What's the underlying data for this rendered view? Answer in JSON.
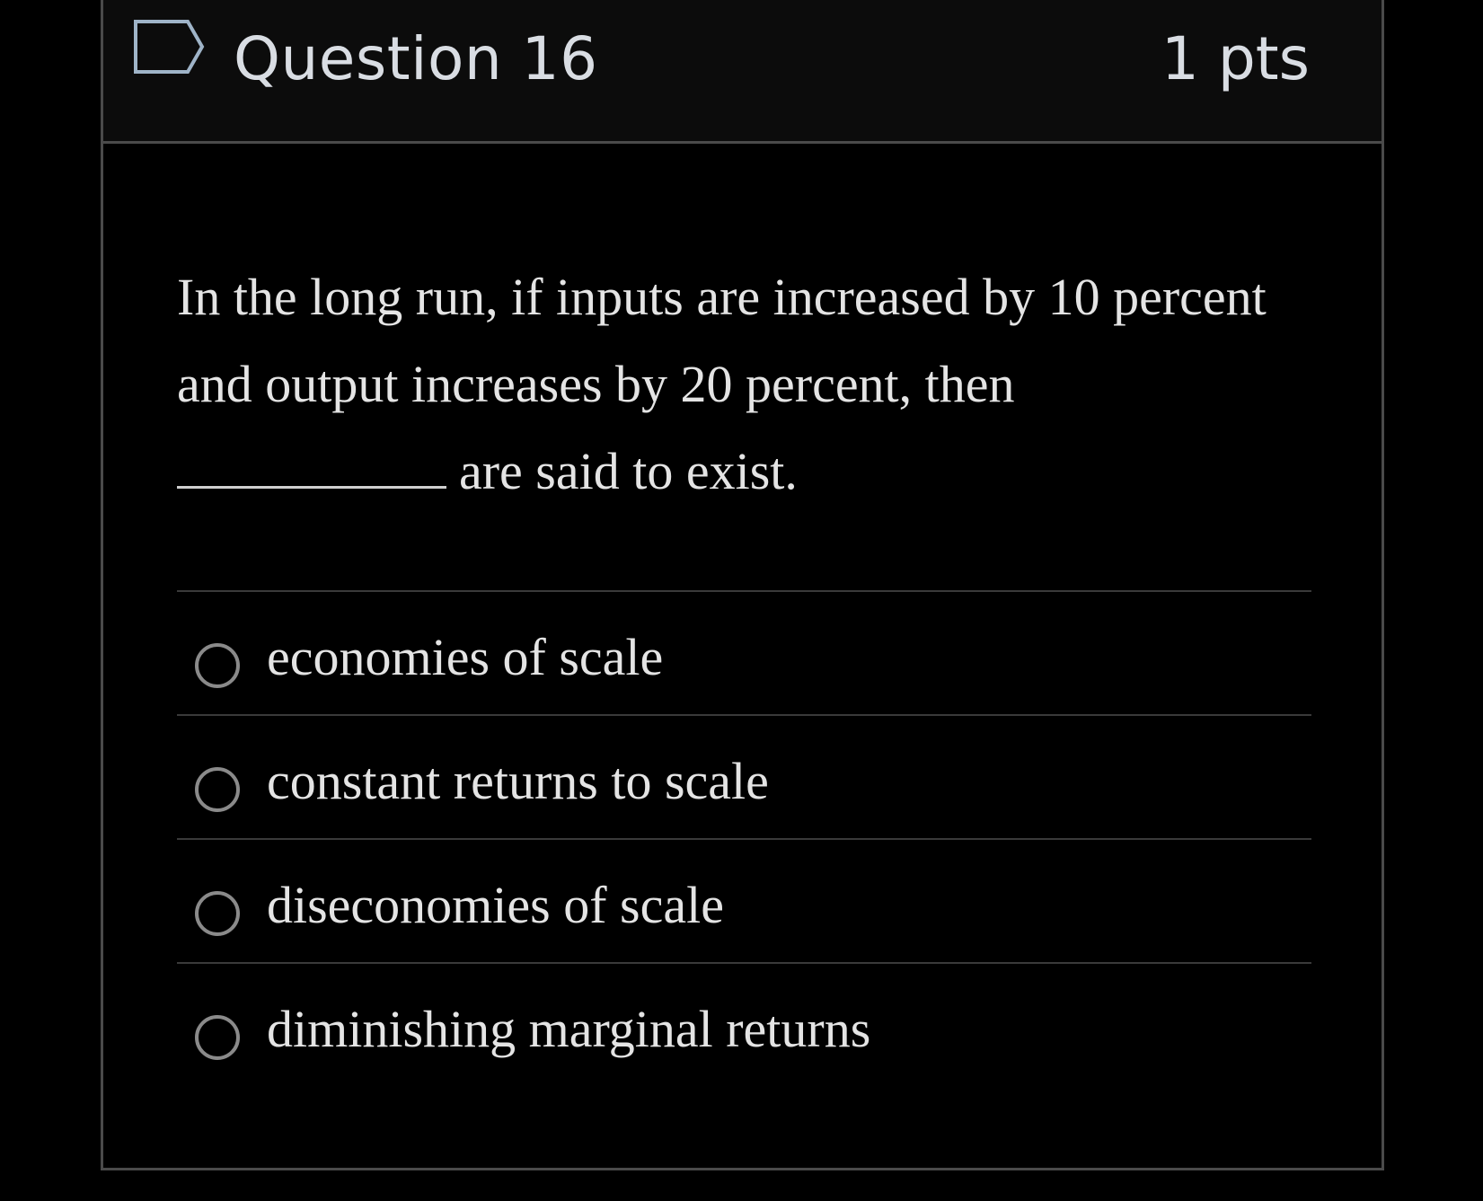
{
  "question": {
    "title": "Question 16",
    "points": "1 pts",
    "flag_icon": "flag-icon",
    "text_line_1": "In the long run, if inputs are increased by 10 percent",
    "text_line_2": "and output increases by 20 percent, then",
    "text_line_3": "are said to exist."
  },
  "answers": [
    {
      "label": "economies of scale",
      "selected": false
    },
    {
      "label": "constant returns to scale",
      "selected": false
    },
    {
      "label": "diseconomies of scale",
      "selected": false
    },
    {
      "label": "diminishing marginal returns",
      "selected": false
    }
  ],
  "colors": {
    "background": "#000000",
    "header_background": "#0c0c0c",
    "border": "#4a4a4a",
    "text": "#e4e4e4",
    "radio_border": "#8a8a8a"
  }
}
